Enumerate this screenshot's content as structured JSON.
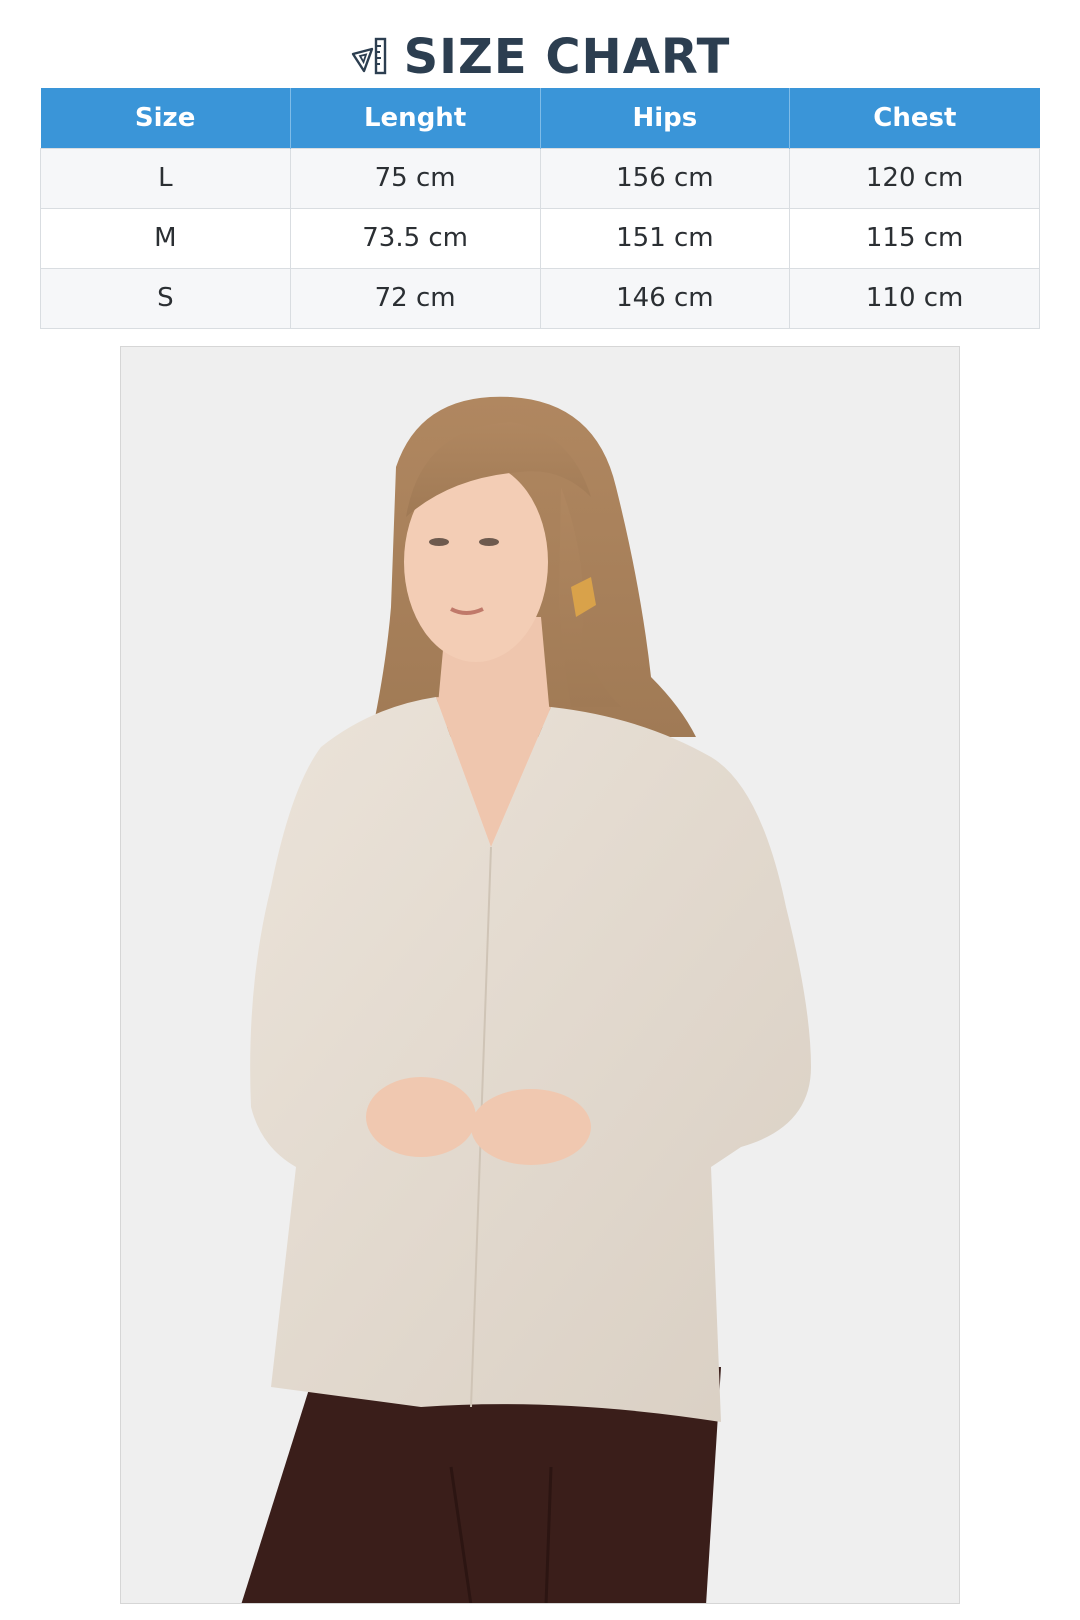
{
  "header": {
    "icon": "ruler-triangle-icon",
    "title": "SIZE CHART"
  },
  "table": {
    "columns": [
      "Size",
      "Lenght",
      "Hips",
      "Chest"
    ],
    "rows": [
      [
        "L",
        "75 cm",
        "156 cm",
        "120 cm"
      ],
      [
        "M",
        "73.5 cm",
        "151 cm",
        "115 cm"
      ],
      [
        "S",
        "72 cm",
        "146 cm",
        "110 cm"
      ]
    ],
    "colors": {
      "header_bg": "#3a95d8",
      "header_text": "#ffffff",
      "row_alt_bg": "#f6f7f9",
      "title_color": "#2c3e50"
    }
  },
  "photo": {
    "subject": "model-wearing-beige-v-neck-top"
  }
}
